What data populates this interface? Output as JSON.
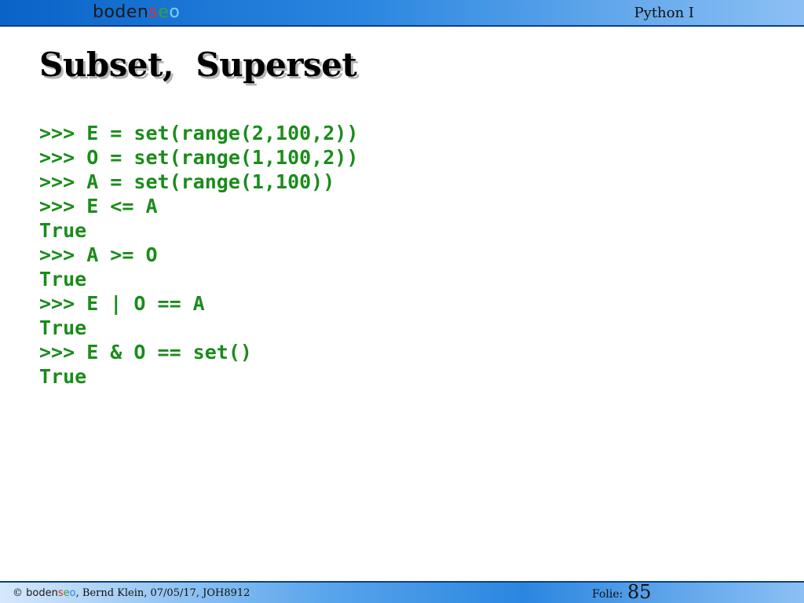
{
  "header": {
    "logo": {
      "part1": "boden",
      "part2": "s",
      "part3": "e",
      "part4": "o"
    },
    "course": "Python I"
  },
  "slide": {
    "title": "Subset,  Superset"
  },
  "code": [
    ">>> E = set(range(2,100,2))",
    ">>> O = set(range(1,100,2))",
    ">>> A = set(range(1,100))",
    ">>> E <= A",
    "True",
    ">>> A >= O",
    "True",
    ">>> E | O == A",
    "True",
    ">>> E & O == set()",
    "True"
  ],
  "footer": {
    "copyright_symbol": "©",
    "logo": {
      "part1": "boden",
      "part2": "s",
      "part3": "e",
      "part4": "o"
    },
    "author_info": ", Bernd Klein, 07/05/17, JOH8912",
    "folie_label": "Folie:",
    "folie_number": "85"
  },
  "colors": {
    "code_green": "#1a8c1a",
    "bar_blue": "#0a63c8",
    "logo_red": "#e03030",
    "logo_green": "#3aa040",
    "logo_lightblue": "#7fd0ff"
  }
}
